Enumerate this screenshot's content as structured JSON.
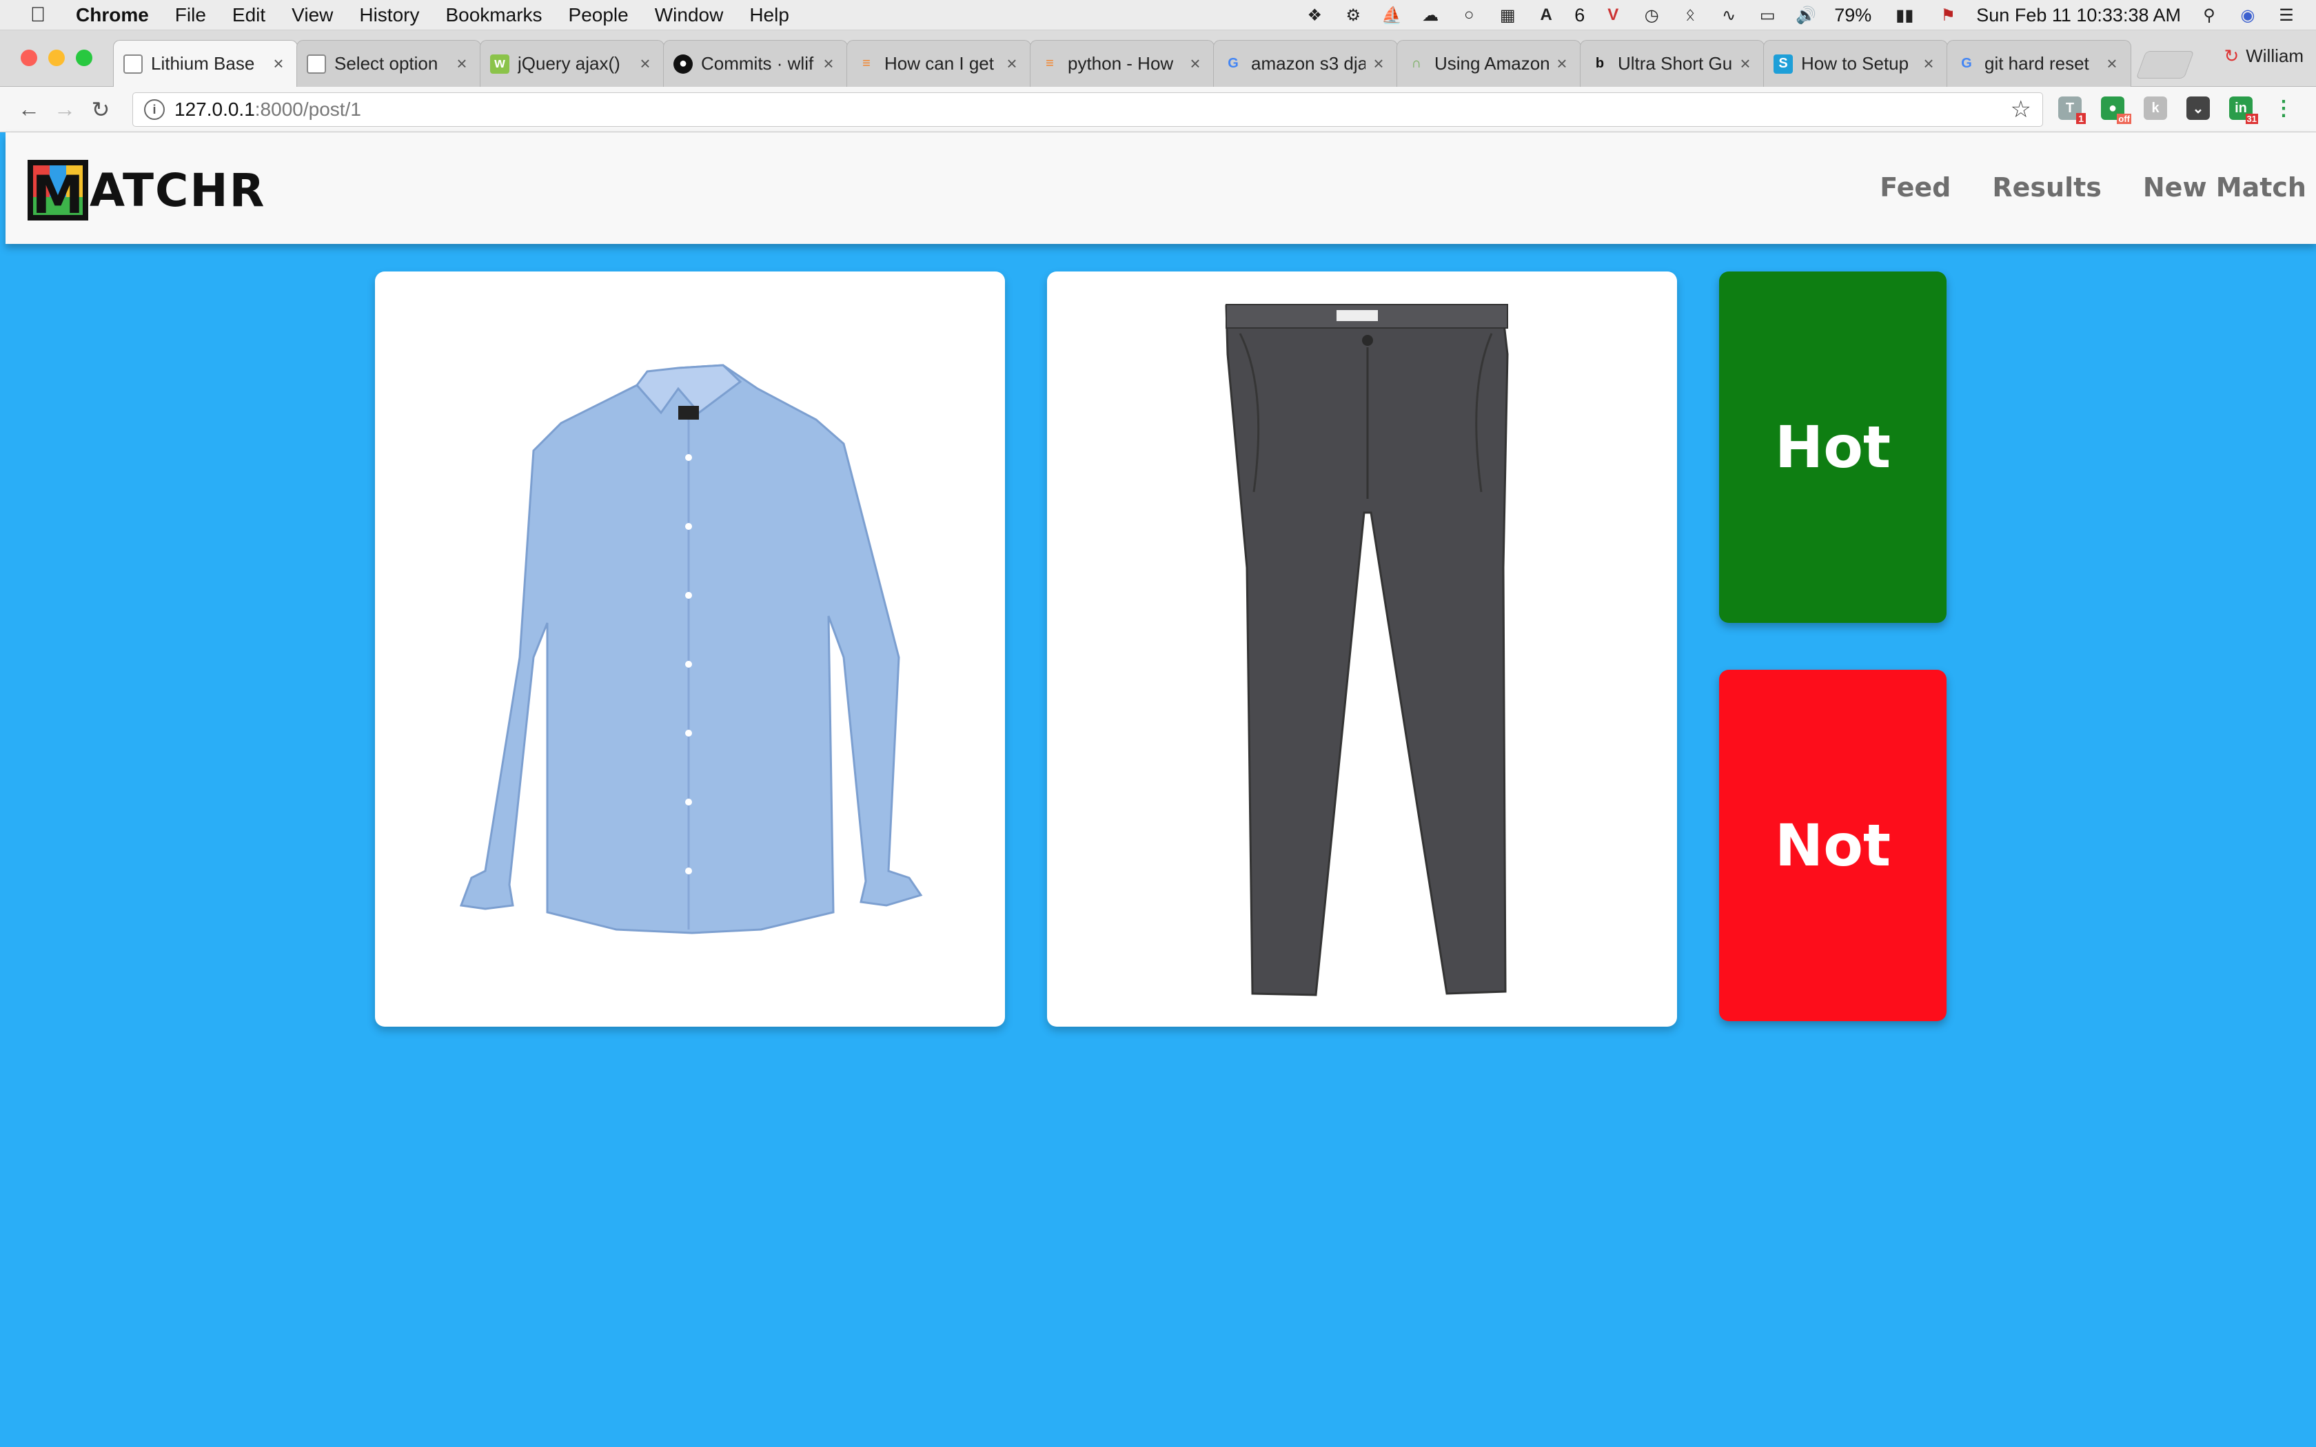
{
  "menubar": {
    "app_name": "Chrome",
    "items": [
      "File",
      "Edit",
      "View",
      "History",
      "Bookmarks",
      "People",
      "Window",
      "Help"
    ],
    "status": {
      "badge_count": "6",
      "battery": "79%",
      "datetime": "Sun Feb 11  10:33:38 AM"
    }
  },
  "tabs": [
    {
      "label": "Lithium Base",
      "active": true
    },
    {
      "label": "Select option"
    },
    {
      "label": "jQuery ajax()"
    },
    {
      "label": "Commits · wlif"
    },
    {
      "label": "How can I get"
    },
    {
      "label": "python - How"
    },
    {
      "label": "amazon s3 dja"
    },
    {
      "label": "Using Amazon"
    },
    {
      "label": "Ultra Short Gu"
    },
    {
      "label": "How to Setup"
    },
    {
      "label": "git hard reset"
    }
  ],
  "profile_name": "William",
  "address": {
    "host": "127.0.0.1",
    "path": ":8000/post/1"
  },
  "extensions": {
    "badge1": "1",
    "badge2": "off",
    "badge3": "31"
  },
  "site": {
    "logo_text": "ATCHR",
    "logo_letter": "M",
    "nav": {
      "feed": "Feed",
      "results": "Results",
      "new_match": "New Match"
    }
  },
  "vote": {
    "hot_label": "Hot",
    "not_label": "Not"
  },
  "colors": {
    "page_bg": "#2aaef7",
    "hot": "#0e7e12",
    "not": "#fd0d1b"
  }
}
